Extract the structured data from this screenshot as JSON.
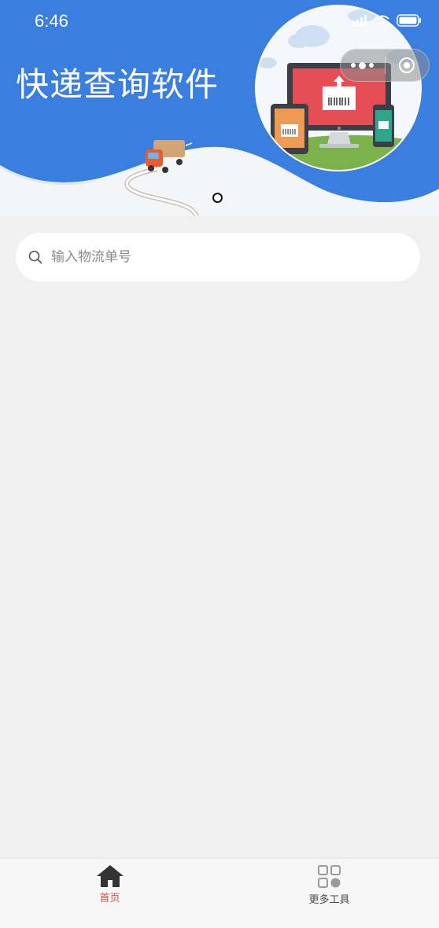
{
  "status_bar": {
    "time": "6:46"
  },
  "header": {
    "title": "快递查询软件"
  },
  "search": {
    "placeholder": "输入物流单号",
    "value": ""
  },
  "tabbar": {
    "items": [
      {
        "label": "首页",
        "icon": "home-icon",
        "active": true
      },
      {
        "label": "更多工具",
        "icon": "grid-icon",
        "active": false
      }
    ]
  },
  "colors": {
    "brand_blue": "#3a7fe0",
    "active_tab": "#e0513b",
    "background": "#f0f0f0"
  }
}
